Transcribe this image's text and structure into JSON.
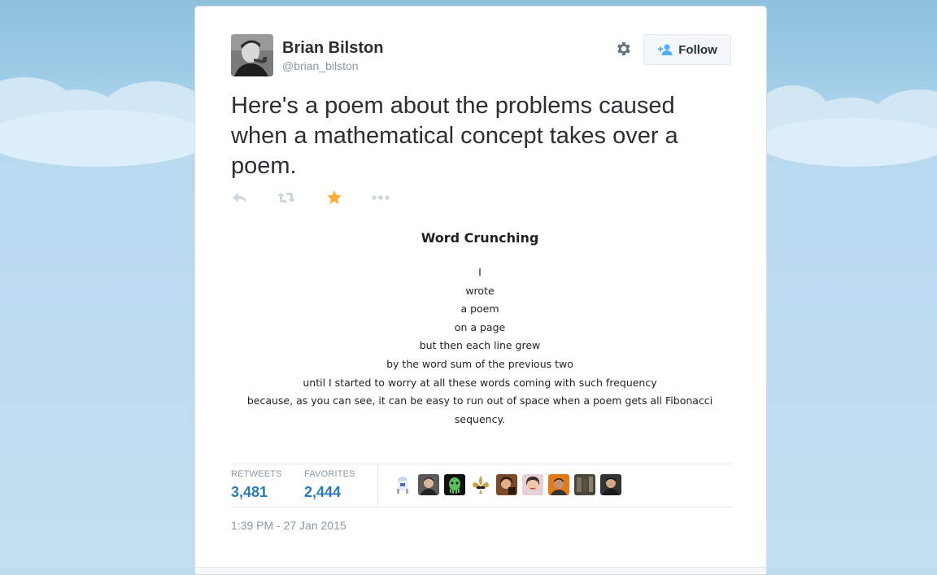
{
  "tweet": {
    "author": {
      "display_name": "Brian Bilston",
      "handle": "@brian_bilston",
      "avatar_icon": "profile-photo-man-with-pipe"
    },
    "follow_label": "Follow",
    "text": "Here's a poem about the problems caused when a mathematical concept takes over a poem.",
    "actions": [
      "reply-icon",
      "retweet-icon",
      "favorite-star-icon",
      "more-icon"
    ],
    "favorite_color": "#ffac33",
    "poem": {
      "title": "Word Crunching",
      "lines": [
        "I",
        "wrote",
        "a poem",
        "on a page",
        "but then each line grew",
        "by the word sum of the previous two",
        "until I started to worry at all these words coming with such frequency",
        "because, as you can see, it can be easy to run out of space when a poem gets all Fibonacci sequency."
      ]
    },
    "stats": {
      "retweets_label": "RETWEETS",
      "retweets_value": "3,481",
      "favorites_label": "FAVORITES",
      "favorites_value": "2,444"
    },
    "favoriter_avatars": [
      "r2d2-avatar",
      "man-avatar",
      "green-alien-avatar",
      "fleur-de-lis-avatar",
      "woman-avatar",
      "woman-smiling-avatar",
      "man-orange-avatar",
      "group-avatar",
      "man-dark-avatar"
    ],
    "timestamp": "1:39 PM - 27 Jan 2015"
  },
  "colors": {
    "link_blue": "#2b7bb9",
    "muted": "#8899a6",
    "text": "#292f33"
  }
}
